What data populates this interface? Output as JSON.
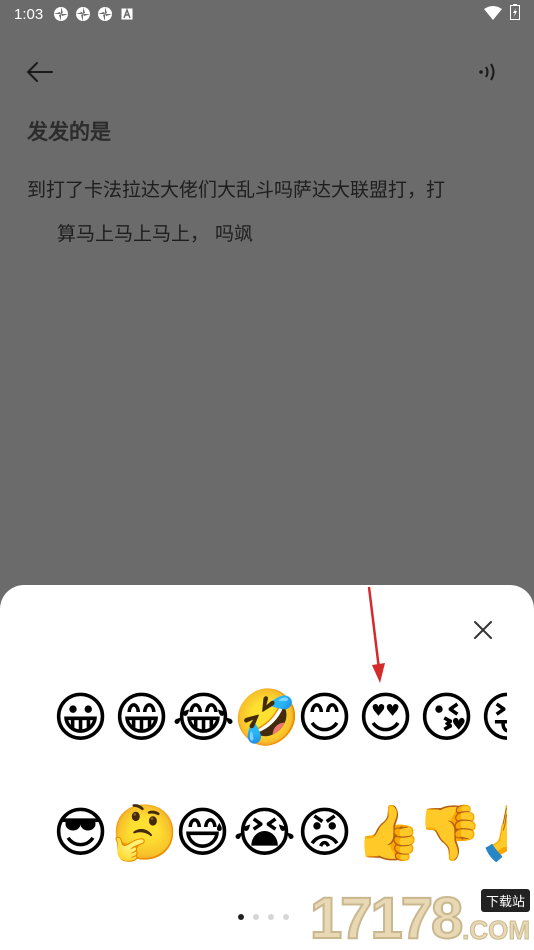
{
  "status_bar": {
    "time": "1:03",
    "icons": [
      "aperture-icon",
      "aperture-icon",
      "aperture-icon",
      "a-box-icon"
    ],
    "right_icons": [
      "wifi-icon",
      "battery-icon"
    ]
  },
  "toolbar": {
    "back_icon": "arrow-left-icon",
    "speak_icon": "read-aloud-icon"
  },
  "note": {
    "title": "发发的是",
    "body_line1": "到打了卡法拉达大佬们大乱斗吗萨达大联盟打，打",
    "body_line2": "算马上马上马上， 吗飒"
  },
  "emoji_panel": {
    "close_icon": "close-icon",
    "row1": [
      "😀",
      "😁",
      "😂",
      "🤣",
      "😊",
      "😍",
      "😘",
      "😝"
    ],
    "row2": [
      "😎",
      "🤔",
      "😅",
      "😭",
      "😡",
      "👍",
      "👎",
      "🙏"
    ],
    "page_count": 4,
    "active_page": 0
  },
  "annotation": {
    "arrow_color": "#d42a2a"
  },
  "watermark": {
    "digits": "17178",
    "badge": "下载站",
    "suffix": ".COM"
  }
}
